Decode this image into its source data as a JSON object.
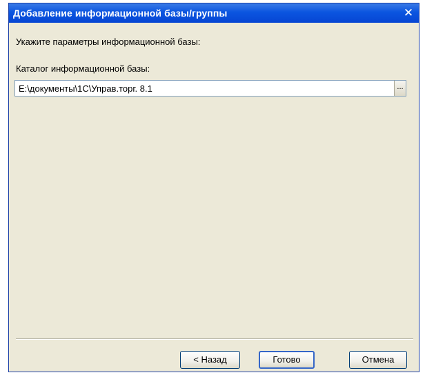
{
  "window": {
    "title": "Добавление информационной базы/группы",
    "close_glyph": "✕"
  },
  "form": {
    "prompt": "Укажите параметры информационной базы:",
    "catalog_label": "Каталог информационной базы:",
    "catalog_value": "E:\\документы\\1С\\Управ.торг. 8.1",
    "browse_label": "..."
  },
  "buttons": {
    "back": "< Назад",
    "done": "Готово",
    "cancel": "Отмена"
  }
}
